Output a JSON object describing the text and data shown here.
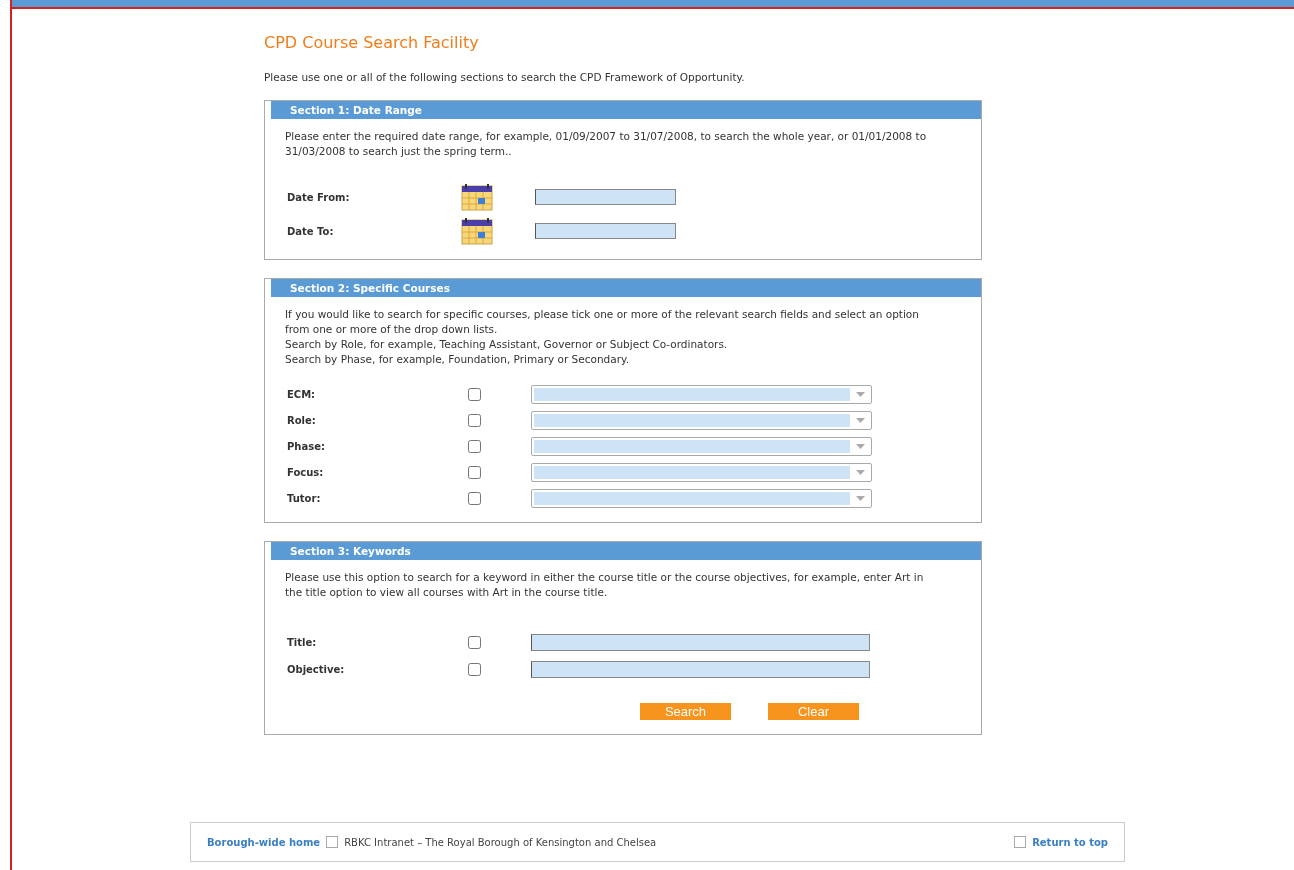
{
  "page": {
    "title": "CPD Course Search Facility",
    "intro": "Please use one or all of the following sections to search the CPD Framework of Opportunity."
  },
  "sections": [
    {
      "kind": "dates",
      "title": "Section 1: Date Range",
      "description": [
        "Please enter the required date range, for example, 01/09/2007 to 31/07/2008, to search the whole year, or 01/01/2008 to 31/03/2008 to search just the spring term.."
      ],
      "fields": [
        {
          "label": "Date From:"
        },
        {
          "label": "Date To:"
        }
      ]
    },
    {
      "kind": "selects",
      "title": "Section 2: Specific Courses",
      "description": [
        "If you would like to search for specific courses, please tick one or more of the relevant search fields and select an option from one or more of the drop down lists.",
        "Search by Role, for example, Teaching Assistant, Governor or Subject Co-ordinators.",
        "Search by Phase, for example, Foundation, Primary or Secondary."
      ],
      "fields": [
        {
          "label": "ECM:",
          "checked": false
        },
        {
          "label": "Role:",
          "checked": false
        },
        {
          "label": "Phase:",
          "checked": false
        },
        {
          "label": "Focus:",
          "checked": false
        },
        {
          "label": "Tutor:",
          "checked": false
        }
      ]
    },
    {
      "kind": "keywords",
      "title": "Section 3: Keywords",
      "description": [
        "Please use this option to search for a keyword in either the course title or the course objectives, for example, enter Art in the title option to view all courses with Art in the course title."
      ],
      "fields": [
        {
          "label": "Title:",
          "checked": false
        },
        {
          "label": "Objective:",
          "checked": false
        }
      ],
      "buttons": [
        "Search",
        "Clear"
      ]
    }
  ],
  "footer": {
    "home_link": "Borough-wide home",
    "site_text": "RBKC Intranet – The Royal Borough of Kensington and Chelsea",
    "top_link": "Return to top"
  }
}
